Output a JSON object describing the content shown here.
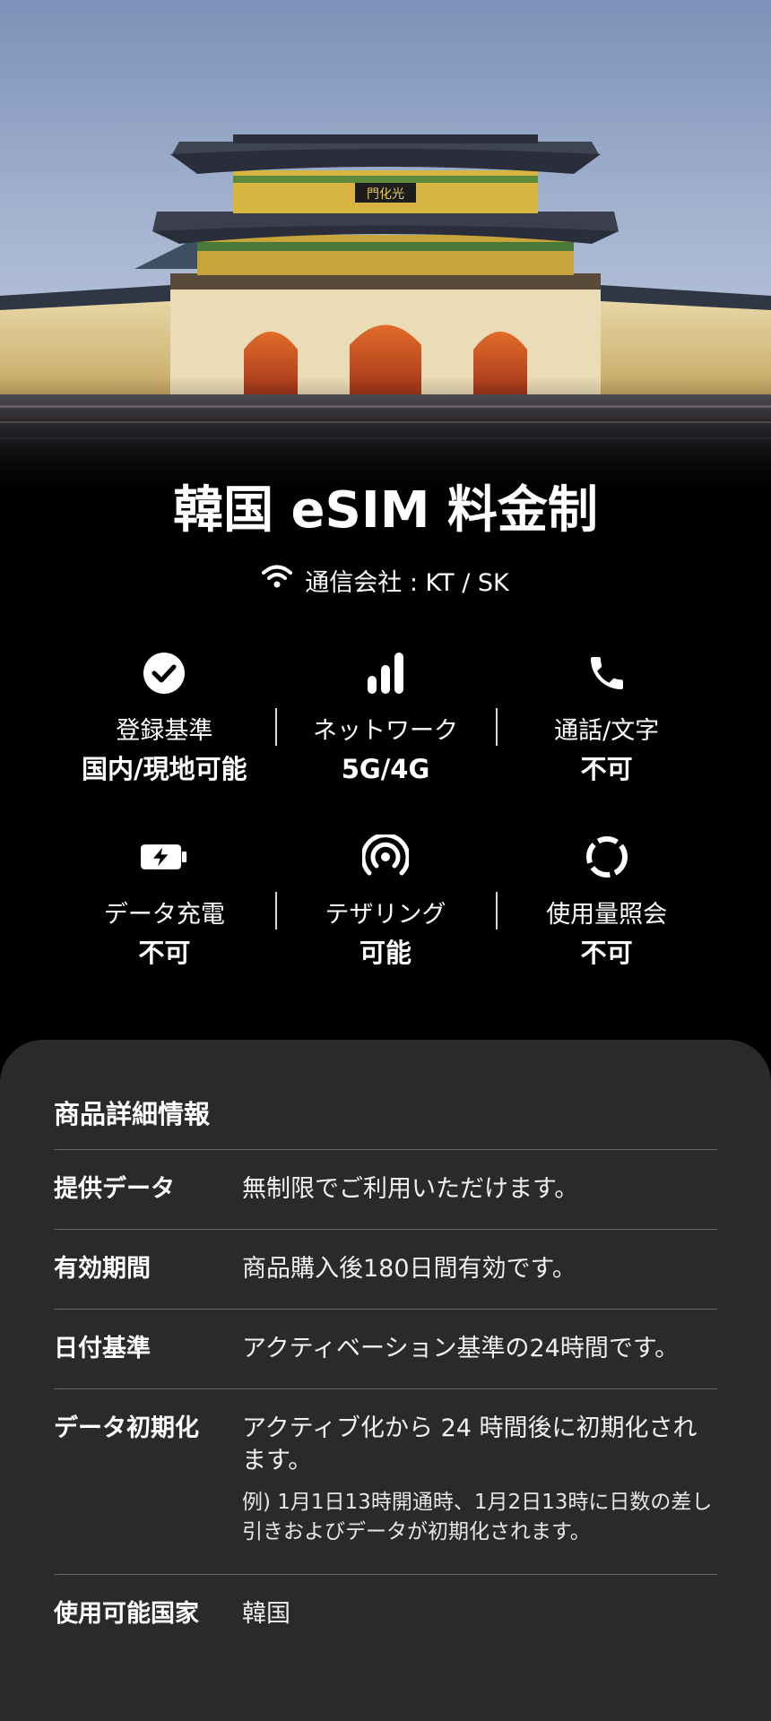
{
  "hero": {
    "image": "gyeongbokgung-gwanghwamun-gate-night-photo",
    "sign_text": "門化光"
  },
  "title": "韓国 eSIM 料金制",
  "carrier": {
    "icon": "wifi-icon",
    "text": "通信会社 : KT / SK"
  },
  "features": [
    {
      "icon": "check-circle-icon",
      "label": "登録基準",
      "value": "国内/現地可能"
    },
    {
      "icon": "signal-bars-icon",
      "label": "ネットワーク",
      "value": "5G/4G"
    },
    {
      "icon": "phone-icon",
      "label": "通話/文字",
      "value": "不可"
    },
    {
      "icon": "battery-charging-icon",
      "label": "データ充電",
      "value": "不可"
    },
    {
      "icon": "hotspot-icon",
      "label": "テザリング",
      "value": "可能"
    },
    {
      "icon": "usage-ring-icon",
      "label": "使用量照会",
      "value": "不可"
    }
  ],
  "details": {
    "title": "商品詳細情報",
    "rows": [
      {
        "key": "提供データ",
        "value": "無制限でご利用いただけます。"
      },
      {
        "key": "有効期間",
        "value": "商品購入後180日間有効です。"
      },
      {
        "key": "日付基準",
        "value": "アクティベーション基準の24時間です。"
      },
      {
        "key": "データ初期化",
        "value": "アクティブ化から 24 時間後に初期化されます。",
        "note": "例) 1月1日13時開通時、1月2日13時に日数の差し引きおよびデータが初期化されます。"
      },
      {
        "key": "使用可能国家",
        "value": "韓国"
      }
    ]
  },
  "colors": {
    "background": "#000000",
    "panel": "#2a2a2a",
    "divider": "#666666",
    "text": "#ffffff"
  }
}
